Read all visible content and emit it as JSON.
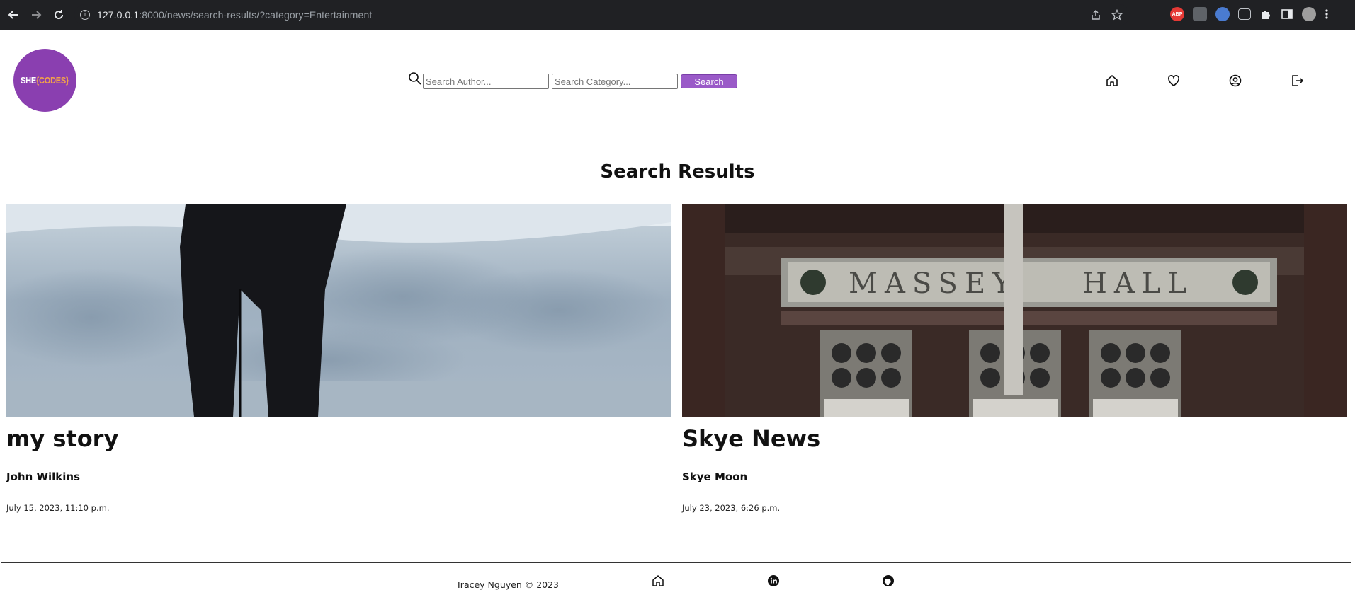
{
  "browser": {
    "url_host": "127.0.0.1",
    "url_rest": ":8000/news/search-results/?category=Entertainment",
    "extensions": [
      "abp-icon",
      "extension-icon",
      "shield-icon",
      "cc-icon",
      "puzzle-icon",
      "sidebar-icon",
      "avatar-icon",
      "menu-icon"
    ],
    "abp_label": "ABP"
  },
  "header": {
    "logo": {
      "she": "SHE",
      "codes": "{CODES}"
    },
    "search": {
      "author_placeholder": "Search Author...",
      "category_placeholder": "Search Category...",
      "button_label": "Search"
    },
    "nav": [
      "home-icon",
      "heart-icon",
      "user-icon",
      "logout-icon"
    ]
  },
  "main": {
    "title": "Search Results",
    "articles": [
      {
        "title": "my story",
        "author": "John Wilkins",
        "date": "July 15, 2023, 11:10 p.m."
      },
      {
        "title": "Skye News",
        "author": "Skye Moon",
        "date": "July 23, 2023, 6:26 p.m."
      }
    ]
  },
  "footer": {
    "credit": "Tracey Nguyen  © 2023",
    "icons": [
      "home-icon",
      "linkedin-icon",
      "github-icon"
    ]
  },
  "colors": {
    "brand_purple": "#8a3fb0",
    "button_purple": "#9a5ac8",
    "logo_accent": "#f2a24a"
  }
}
